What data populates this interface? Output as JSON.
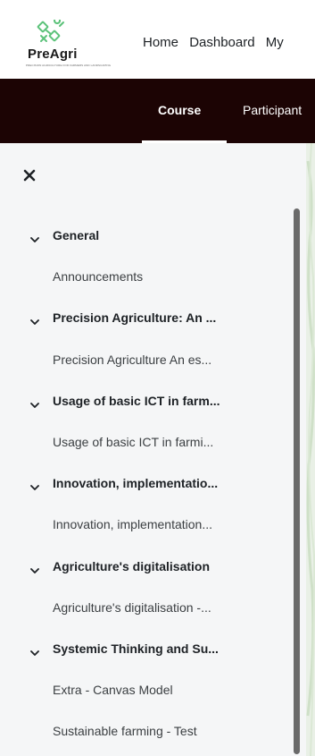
{
  "brand": {
    "name": "PreAgri",
    "tagline": "PRECISION AGRICULTURE FOR FARMERS AND LANDSCAPING",
    "accent_color": "#5cc27a"
  },
  "navbar": {
    "links": [
      "Home",
      "Dashboard",
      "My"
    ]
  },
  "secondary_nav": {
    "tabs": [
      {
        "label": "Course",
        "active": true
      },
      {
        "label": "Participant",
        "active": false
      }
    ],
    "background": "#1c0404"
  },
  "course_index": {
    "close_icon": "close-icon",
    "items": [
      {
        "type": "section",
        "label": "General"
      },
      {
        "type": "activity",
        "label": "Announcements"
      },
      {
        "type": "section",
        "label": "Precision Agriculture: An ..."
      },
      {
        "type": "activity",
        "label": "Precision Agriculture An es..."
      },
      {
        "type": "section",
        "label": "Usage of basic ICT in farm..."
      },
      {
        "type": "activity",
        "label": "Usage of basic ICT in farmi..."
      },
      {
        "type": "section",
        "label": "Innovation, implementatio..."
      },
      {
        "type": "activity",
        "label": "Innovation, implementation..."
      },
      {
        "type": "section",
        "label": "Agriculture's digitalisation"
      },
      {
        "type": "activity",
        "label": "Agriculture's digitalisation -..."
      },
      {
        "type": "section",
        "label": "Systemic Thinking and Su..."
      },
      {
        "type": "activity",
        "label": "Extra - Canvas Model"
      },
      {
        "type": "activity",
        "label": "Sustainable farming - Test"
      }
    ]
  }
}
